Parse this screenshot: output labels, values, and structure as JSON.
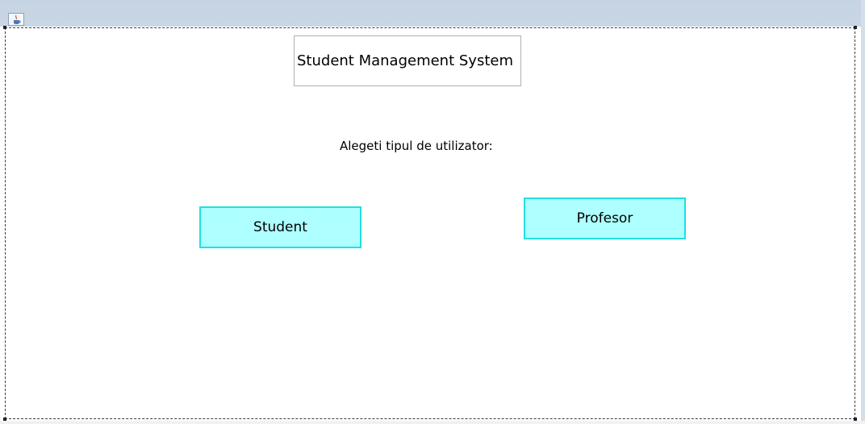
{
  "window": {
    "icon": "java-icon"
  },
  "header": {
    "title": "Student Management System"
  },
  "main": {
    "prompt": "Alegeti tipul de utilizator:",
    "buttons": {
      "student_label": "Student",
      "profesor_label": "Profesor"
    }
  },
  "colors": {
    "button_fill": "#aeffff",
    "button_border": "#22dfe0"
  }
}
